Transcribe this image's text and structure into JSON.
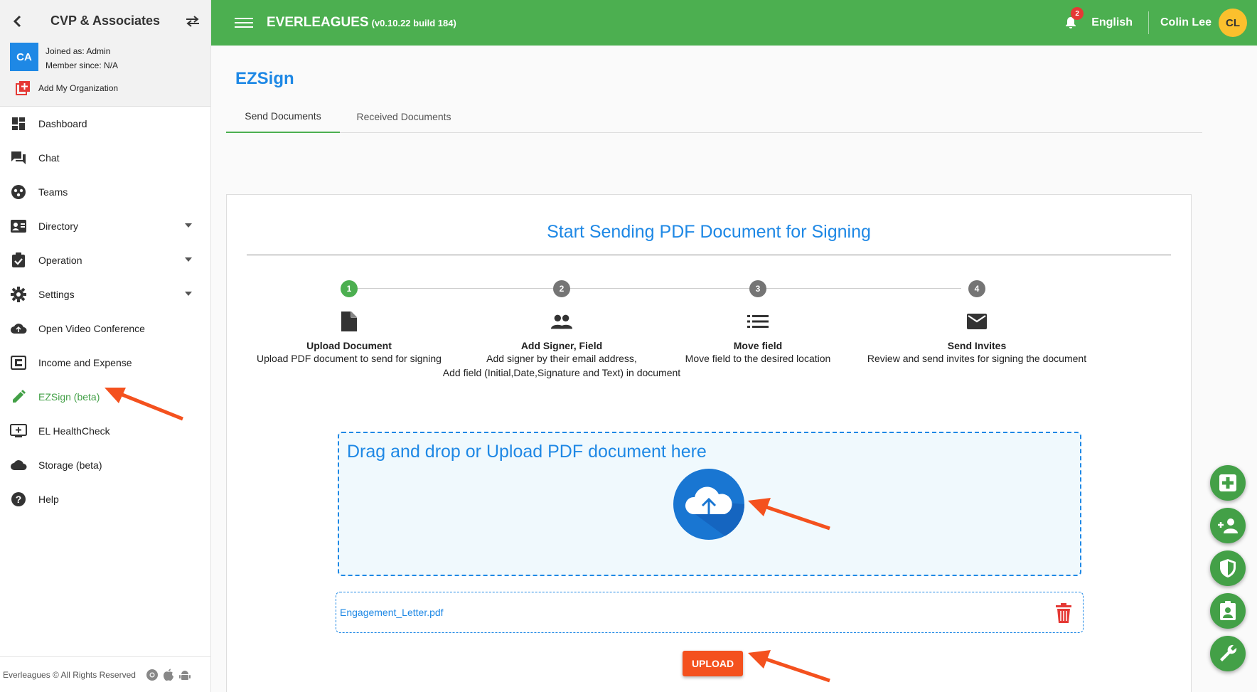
{
  "sidebar": {
    "org_name": "CVP & Associates",
    "org_initials": "CA",
    "joined_as": "Joined as: Admin",
    "member_since": "Member since: N/A",
    "add_org_label": "Add My Organization",
    "items": [
      {
        "label": "Dashboard",
        "icon": "dashboard-icon"
      },
      {
        "label": "Chat",
        "icon": "chat-icon"
      },
      {
        "label": "Teams",
        "icon": "teams-icon"
      },
      {
        "label": "Directory",
        "icon": "contacts-icon",
        "has_submenu": true
      },
      {
        "label": "Operation",
        "icon": "clipboard-check-icon",
        "has_submenu": true
      },
      {
        "label": "Settings",
        "icon": "gear-icon",
        "has_submenu": true
      },
      {
        "label": "Open Video Conference",
        "icon": "cloud-icon"
      },
      {
        "label": "Income and Expense",
        "icon": "ledger-icon"
      },
      {
        "label": "EZSign (beta)",
        "icon": "pencil-icon",
        "active": true
      },
      {
        "label": "EL HealthCheck",
        "icon": "monitor-plus-icon"
      },
      {
        "label": "Storage (beta)",
        "icon": "cloud-storage-icon"
      },
      {
        "label": "Help",
        "icon": "help-icon"
      }
    ],
    "footer": "Everleagues © All Rights Reserved",
    "platforms": [
      "chrome-icon",
      "apple-icon",
      "android-icon"
    ]
  },
  "topbar": {
    "title": "EVERLEAGUES",
    "version": "(v0.10.22 build 184)",
    "notification_count": "2",
    "language": "English",
    "user_name": "Colin Lee",
    "user_initials": "CL"
  },
  "page": {
    "title": "EZSign",
    "tabs": [
      {
        "label": "Send Documents",
        "active": true
      },
      {
        "label": "Received Documents",
        "active": false
      }
    ]
  },
  "card": {
    "title": "Start Sending PDF Document for Signing",
    "steps": [
      {
        "num": "1",
        "title": "Upload Document",
        "desc": [
          "Upload PDF document to send for signing"
        ],
        "icon": "file-icon",
        "done": true
      },
      {
        "num": "2",
        "title": "Add Signer, Field",
        "desc": [
          "Add signer by their email address,",
          "Add field (Initial,Date,Signature and Text) in document"
        ],
        "icon": "people-icon",
        "done": false
      },
      {
        "num": "3",
        "title": "Move field",
        "desc": [
          "Move field to the desired location"
        ],
        "icon": "list-icon",
        "done": false
      },
      {
        "num": "4",
        "title": "Send Invites",
        "desc": [
          "Review and send invites for signing the document"
        ],
        "icon": "mail-icon",
        "done": false
      }
    ],
    "dropzone_text": "Drag and drop or Upload PDF document here",
    "file_name": "Engagement_Letter.pdf",
    "upload_label": "UPLOAD"
  },
  "fabs": [
    "add-medical-icon",
    "add-person-icon",
    "shield-icon",
    "contact-badge-icon",
    "wrench-icon"
  ],
  "colors": {
    "brand_green": "#4caf50",
    "accent_blue": "#1e88e5",
    "upload_orange": "#f4511e",
    "annotation_arrow": "#f4511e"
  }
}
